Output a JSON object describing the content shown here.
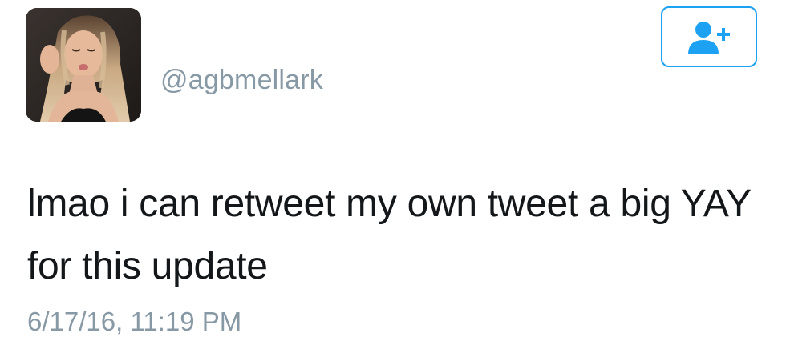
{
  "user": {
    "handle": "@agbmellark"
  },
  "follow_button": {
    "icon": "add-user-icon",
    "color": "#1da1f2"
  },
  "tweet": {
    "text": "lmao i can retweet my own tweet a big YAY for this update",
    "timestamp": "6/17/16, 11:19 PM"
  },
  "colors": {
    "text": "#14171a",
    "secondary": "#8899a6",
    "accent": "#1da1f2"
  }
}
